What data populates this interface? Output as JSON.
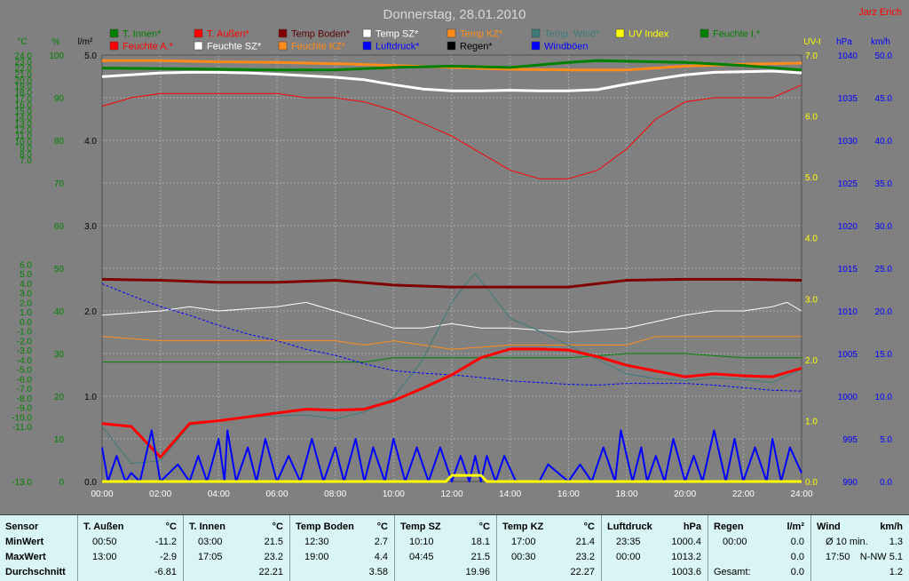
{
  "title": "Donnerstag, 28.01.2010",
  "author": "Jarz Erich",
  "colors": {
    "grid_bg": "#808080",
    "t_innen": "#008000",
    "t_aussen": "#ff0000",
    "temp_boden": "#800000",
    "temp_sz": "#ffffff",
    "temp_kz": "#ff8c1a",
    "temp_wind": "#3d7a7a",
    "uv": "#ffff00",
    "feuchte_i": "#008000",
    "feuchte_a": "#ff0000",
    "feuchte_sz": "#ffffff",
    "feuchte_kz": "#ff8c1a",
    "luftdruck": "#0000ff",
    "regen": "#000000",
    "windboeen": "#0000ff"
  },
  "chart_data": {
    "type": "line",
    "x_ticks": [
      "00:00",
      "02:00",
      "04:00",
      "06:00",
      "08:00",
      "10:00",
      "12:00",
      "14:00",
      "16:00",
      "18:00",
      "20:00",
      "22:00",
      "24:00"
    ],
    "axes": {
      "celsius": {
        "unit": "°C",
        "ticks": [
          "24.0",
          "23.0",
          "22.0",
          "21.0",
          "20.0",
          "19.0",
          "18.0",
          "17.0",
          "16.0",
          "15.0",
          "14.0",
          "13.0",
          "12.0",
          "11.0",
          "10.0",
          "9.0",
          "8.0",
          "7.0",
          "6.0",
          "5.0",
          "4.0",
          "3.0",
          "2.0",
          "1.0",
          "0.0",
          "-1.0",
          "-2.0",
          "-3.0",
          "-4.0",
          "-5.0",
          "-6.0",
          "-7.0",
          "-8.0",
          "-9.0",
          "-10.0",
          "-11.0",
          "-13.0"
        ]
      },
      "percent": {
        "unit": "%",
        "ticks": [
          "100",
          "90",
          "80",
          "70",
          "60",
          "50",
          "40",
          "30",
          "20",
          "10",
          "0"
        ]
      },
      "rain": {
        "unit": "l/m²",
        "ticks": [
          "5.0",
          "4.0",
          "3.0",
          "2.0",
          "1.0",
          "0.0"
        ]
      },
      "uv": {
        "unit": "UV-I",
        "ticks": [
          "7.0",
          "6.0",
          "5.0",
          "4.0",
          "3.0",
          "2.0",
          "1.0",
          "0.0"
        ]
      },
      "pressure": {
        "unit": "hPa",
        "ticks": [
          "1040",
          "1035",
          "1030",
          "1025",
          "1020",
          "1015",
          "1010",
          "1005",
          "1000",
          "995",
          "990"
        ]
      },
      "wind": {
        "unit": "km/h",
        "ticks": [
          "50.0",
          "45.0",
          "40.0",
          "35.0",
          "30.0",
          "25.0",
          "20.0",
          "15.0",
          "10.0",
          "5.0",
          "0.0"
        ]
      }
    },
    "legend": [
      "T. Innen*",
      "T. Außen*",
      "Temp Boden*",
      "Temp SZ*",
      "Temp KZ*",
      "Temp. Wind*",
      "UV Index",
      "Feuchte I.*",
      "Feuchte A.*",
      "Feuchte SZ*",
      "Feuchte KZ*",
      "Luftdruck*",
      "Regen*",
      "Windböen"
    ],
    "series": [
      {
        "name": "T. Außen*",
        "axis": "celsius",
        "x": [
          0,
          1,
          2,
          3,
          4,
          5,
          6,
          7,
          8,
          9,
          10,
          11,
          12,
          13,
          14,
          15,
          16,
          17,
          18,
          19,
          20,
          21,
          22,
          23,
          24
        ],
        "values": [
          -10.7,
          -11.0,
          -11.1,
          -10.7,
          -10.4,
          -10.0,
          -9.6,
          -9.2,
          -9.3,
          -9.2,
          -8.3,
          -7.0,
          -5.6,
          -3.8,
          -2.9,
          -2.9,
          -3.0,
          -3.7,
          -4.6,
          -5.2,
          -5.8,
          -5.5,
          -5.7,
          -5.8,
          -4.9
        ]
      },
      {
        "name": "T. Innen*",
        "axis": "celsius",
        "x": [
          0,
          2,
          4,
          6,
          8,
          10,
          12,
          14,
          16,
          17,
          18,
          20,
          22,
          24
        ],
        "values": [
          21.9,
          21.8,
          21.7,
          21.6,
          21.6,
          22.0,
          22.2,
          22.0,
          22.8,
          23.1,
          23.0,
          22.8,
          22.3,
          21.6
        ]
      },
      {
        "name": "Temp Boden*",
        "axis": "celsius",
        "x": [
          0,
          2,
          4,
          6,
          8,
          10,
          12,
          14,
          16,
          18,
          20,
          22,
          24
        ],
        "values": [
          4.4,
          4.3,
          4.1,
          4.1,
          4.3,
          3.8,
          3.6,
          3.6,
          3.6,
          4.3,
          4.4,
          4.4,
          4.3
        ]
      },
      {
        "name": "Temp SZ*",
        "axis": "celsius",
        "x": [
          0,
          2,
          3,
          4,
          5,
          6,
          8,
          9,
          10,
          11,
          12,
          13,
          14,
          15,
          16,
          17,
          18,
          19,
          20,
          21,
          22,
          23,
          24
        ],
        "values": [
          20.5,
          21.1,
          21.2,
          21.2,
          21.1,
          20.9,
          20.4,
          20.0,
          19.2,
          18.5,
          18.2,
          18.2,
          18.3,
          18.2,
          18.2,
          18.4,
          19.3,
          20.1,
          20.8,
          21.2,
          21.3,
          21.4,
          21.1
        ]
      },
      {
        "name": "Temp KZ*",
        "axis": "celsius",
        "x": [
          0,
          2,
          4,
          6,
          8,
          10,
          12,
          14,
          16,
          18,
          20,
          22,
          24
        ],
        "values": [
          23.1,
          23.1,
          22.9,
          22.8,
          22.6,
          22.3,
          22.0,
          21.7,
          21.6,
          21.6,
          22.2,
          22.5,
          22.7
        ]
      },
      {
        "name": "Temp. Wind*",
        "axis": "celsius",
        "x": [
          0,
          1,
          2,
          3,
          4,
          5,
          6,
          7,
          8,
          9,
          10,
          11,
          11.5,
          12,
          12.5,
          12.8,
          13.2,
          14,
          15,
          16,
          17,
          18,
          19,
          20,
          21,
          22,
          23,
          24
        ],
        "values": [
          -11.0,
          -11.6,
          -11.4,
          -10.9,
          -10.4,
          -10.0,
          -9.9,
          -9.8,
          -10.2,
          -9.5,
          -8.0,
          -4.0,
          -1.0,
          2.0,
          4.0,
          5.0,
          3.5,
          0.3,
          -1.0,
          -2.5,
          -4.0,
          -5.5,
          -6.0,
          -6.2,
          -5.9,
          -6.1,
          -6.4,
          -5.0
        ]
      },
      {
        "name": "Feuchte I.*",
        "axis": "percent",
        "x": [
          0,
          2,
          4,
          6,
          8,
          9,
          10,
          12,
          14,
          16,
          18,
          20,
          22,
          24
        ],
        "values": [
          28,
          28,
          28,
          28,
          28,
          28,
          29,
          29,
          29,
          29,
          30,
          30,
          29,
          29
        ]
      },
      {
        "name": "Feuchte A.*",
        "axis": "percent",
        "x": [
          0,
          1,
          2,
          3,
          4,
          5,
          6,
          7,
          8,
          9,
          10,
          11,
          12,
          13,
          14,
          15,
          16,
          17,
          18,
          19,
          20,
          21,
          22,
          23,
          24
        ],
        "values": [
          88,
          90,
          91,
          91,
          91,
          91,
          91,
          90,
          90,
          89,
          87,
          84,
          81,
          77,
          73,
          71,
          71,
          73,
          78,
          85,
          89,
          90,
          90,
          90,
          93
        ]
      },
      {
        "name": "Feuchte SZ*",
        "axis": "percent",
        "x": [
          0,
          2,
          3,
          4,
          6,
          7,
          8,
          9,
          10,
          11,
          12,
          13,
          14,
          16,
          18,
          20,
          21,
          22,
          23,
          23.5,
          24
        ],
        "values": [
          39,
          40,
          41,
          40,
          41,
          42,
          40,
          38,
          36,
          36,
          37,
          36,
          36,
          35,
          36,
          39,
          40,
          40,
          41,
          42,
          40
        ]
      },
      {
        "name": "Feuchte KZ*",
        "axis": "percent",
        "x": [
          0,
          2,
          4,
          6,
          8,
          9,
          10,
          11,
          12,
          14,
          16,
          18,
          19,
          20,
          22,
          24
        ],
        "values": [
          34,
          33,
          33,
          33,
          33,
          32,
          33,
          32,
          31,
          32,
          32,
          32,
          34,
          34,
          34,
          34
        ]
      },
      {
        "name": "Luftdruck*",
        "axis": "pressure",
        "x": [
          0,
          1,
          2,
          3,
          4,
          5,
          6,
          7,
          8,
          9,
          10,
          11,
          12,
          13,
          14,
          15,
          16,
          17,
          18,
          19,
          20,
          21,
          22,
          23,
          24
        ],
        "values": [
          1013.2,
          1011.8,
          1010.5,
          1009.5,
          1008.3,
          1007.3,
          1006.5,
          1005.5,
          1004.8,
          1003.8,
          1003.0,
          1002.7,
          1002.5,
          1002.2,
          1001.8,
          1001.6,
          1001.4,
          1001.3,
          1001.5,
          1001.5,
          1001.5,
          1001.3,
          1001.0,
          1000.7,
          1000.6
        ]
      },
      {
        "name": "Windböen",
        "axis": "wind",
        "x": [
          0,
          0.2,
          0.5,
          0.8,
          1.0,
          1.3,
          1.7,
          2.0,
          2.6,
          3.0,
          3.3,
          3.6,
          4.0,
          4.2,
          4.3,
          4.6,
          5.0,
          5.3,
          5.6,
          6.0,
          6.4,
          6.8,
          7.2,
          7.6,
          8.0,
          8.3,
          8.7,
          9.0,
          9.3,
          9.7,
          10.0,
          10.4,
          10.8,
          11.2,
          11.6,
          12.0,
          12.3,
          12.6,
          12.8,
          13.0,
          13.2,
          13.5,
          13.8,
          14.2,
          15.0,
          15.3,
          16.0,
          16.4,
          16.8,
          17.2,
          17.6,
          17.8,
          18.2,
          18.5,
          18.7,
          19.0,
          19.3,
          19.6,
          20.0,
          20.3,
          20.6,
          21.0,
          21.4,
          21.7,
          22.0,
          22.4,
          22.8,
          23.0,
          23.3,
          23.6,
          24.0
        ],
        "values": [
          4,
          0,
          3,
          0,
          1,
          0,
          6,
          0,
          2,
          0,
          3,
          0,
          5,
          0,
          6,
          0,
          4,
          0,
          5,
          0,
          3,
          0,
          5,
          0,
          4,
          0,
          5,
          0,
          4,
          0,
          5,
          0,
          4,
          0,
          4,
          0,
          3,
          0,
          3,
          0,
          3,
          0,
          3,
          0,
          0,
          2,
          0,
          2,
          0,
          4,
          0,
          6,
          0,
          4,
          0,
          3,
          0,
          5,
          0,
          3,
          0,
          6,
          0,
          5,
          0,
          4,
          0,
          5,
          0,
          4,
          1
        ]
      },
      {
        "name": "UV Index",
        "axis": "uv",
        "x": [
          0,
          11.8,
          12.0,
          13.0,
          13.2,
          24
        ],
        "values": [
          0,
          0,
          0.1,
          0.1,
          0,
          0
        ]
      }
    ]
  },
  "stats": {
    "labels": {
      "sensor": "Sensor",
      "min": "MinWert",
      "max": "MaxWert",
      "avg": "Durchschnitt"
    },
    "columns": [
      {
        "title": "T. Außen",
        "unit": "°C",
        "min_time": "00:50",
        "min": "-11.2",
        "max_time": "13:00",
        "max": "-2.9",
        "avg": "-6.81"
      },
      {
        "title": "T. Innen",
        "unit": "°C",
        "min_time": "03:00",
        "min": "21.5",
        "max_time": "17:05",
        "max": "23.2",
        "avg": "22.21"
      },
      {
        "title": "Temp Boden",
        "unit": "°C",
        "min_time": "12:30",
        "min": "2.7",
        "max_time": "19:00",
        "max": "4.4",
        "avg": "3.58"
      },
      {
        "title": "Temp SZ",
        "unit": "°C",
        "min_time": "10:10",
        "min": "18.1",
        "max_time": "04:45",
        "max": "21.5",
        "avg": "19.96"
      },
      {
        "title": "Temp KZ",
        "unit": "°C",
        "min_time": "17:00",
        "min": "21.4",
        "max_time": "00:30",
        "max": "23.2",
        "avg": "22.27"
      },
      {
        "title": "Luftdruck",
        "unit": "hPa",
        "min_time": "23:35",
        "min": "1000.4",
        "max_time": "00:00",
        "max": "1013.2",
        "avg": "1003.6"
      }
    ],
    "regen": {
      "title": "Regen",
      "unit": "l/m²",
      "min_time": "00:00",
      "min": "0.0",
      "max_time": "",
      "max": "0.0",
      "avg_label": "Gesamt:",
      "avg": "0.0"
    },
    "wind": {
      "title": "Wind",
      "unit": "km/h",
      "row1_label": "Ø 10 min.",
      "row1_value": "1.3",
      "row2_time": "17:50",
      "row2_value": "N-NW 5.1",
      "avg": "1.2"
    }
  }
}
